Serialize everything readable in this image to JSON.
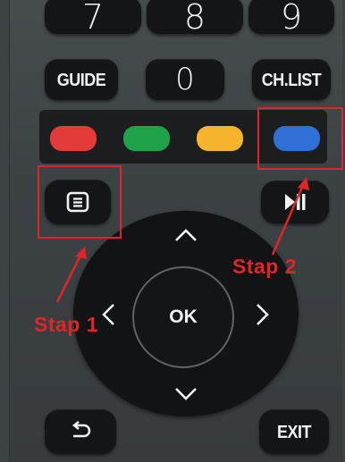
{
  "remote": {
    "digits": [
      "7",
      "8",
      "9"
    ],
    "guide_label": "GUIDE",
    "zero_label": "0",
    "chlist_label": "CH.LIST",
    "ok_label": "OK",
    "exit_label": "EXIT",
    "color_buttons": [
      {
        "color": "#e33a3a",
        "name": "red"
      },
      {
        "color": "#1fa24a",
        "name": "green"
      },
      {
        "color": "#f6b52c",
        "name": "yellow"
      },
      {
        "color": "#2f6fd6",
        "name": "blue"
      }
    ],
    "icons": {
      "menu": "menu-list-icon",
      "play_pause": "play-pause-icon",
      "back": "back-return-icon",
      "up": "chevron-up-icon",
      "down": "chevron-down-icon",
      "left": "chevron-left-icon",
      "right": "chevron-right-icon"
    }
  },
  "annotations": {
    "step1": "Stap 1",
    "step2": "Stap 2",
    "highlight_color": "#e0252a"
  }
}
